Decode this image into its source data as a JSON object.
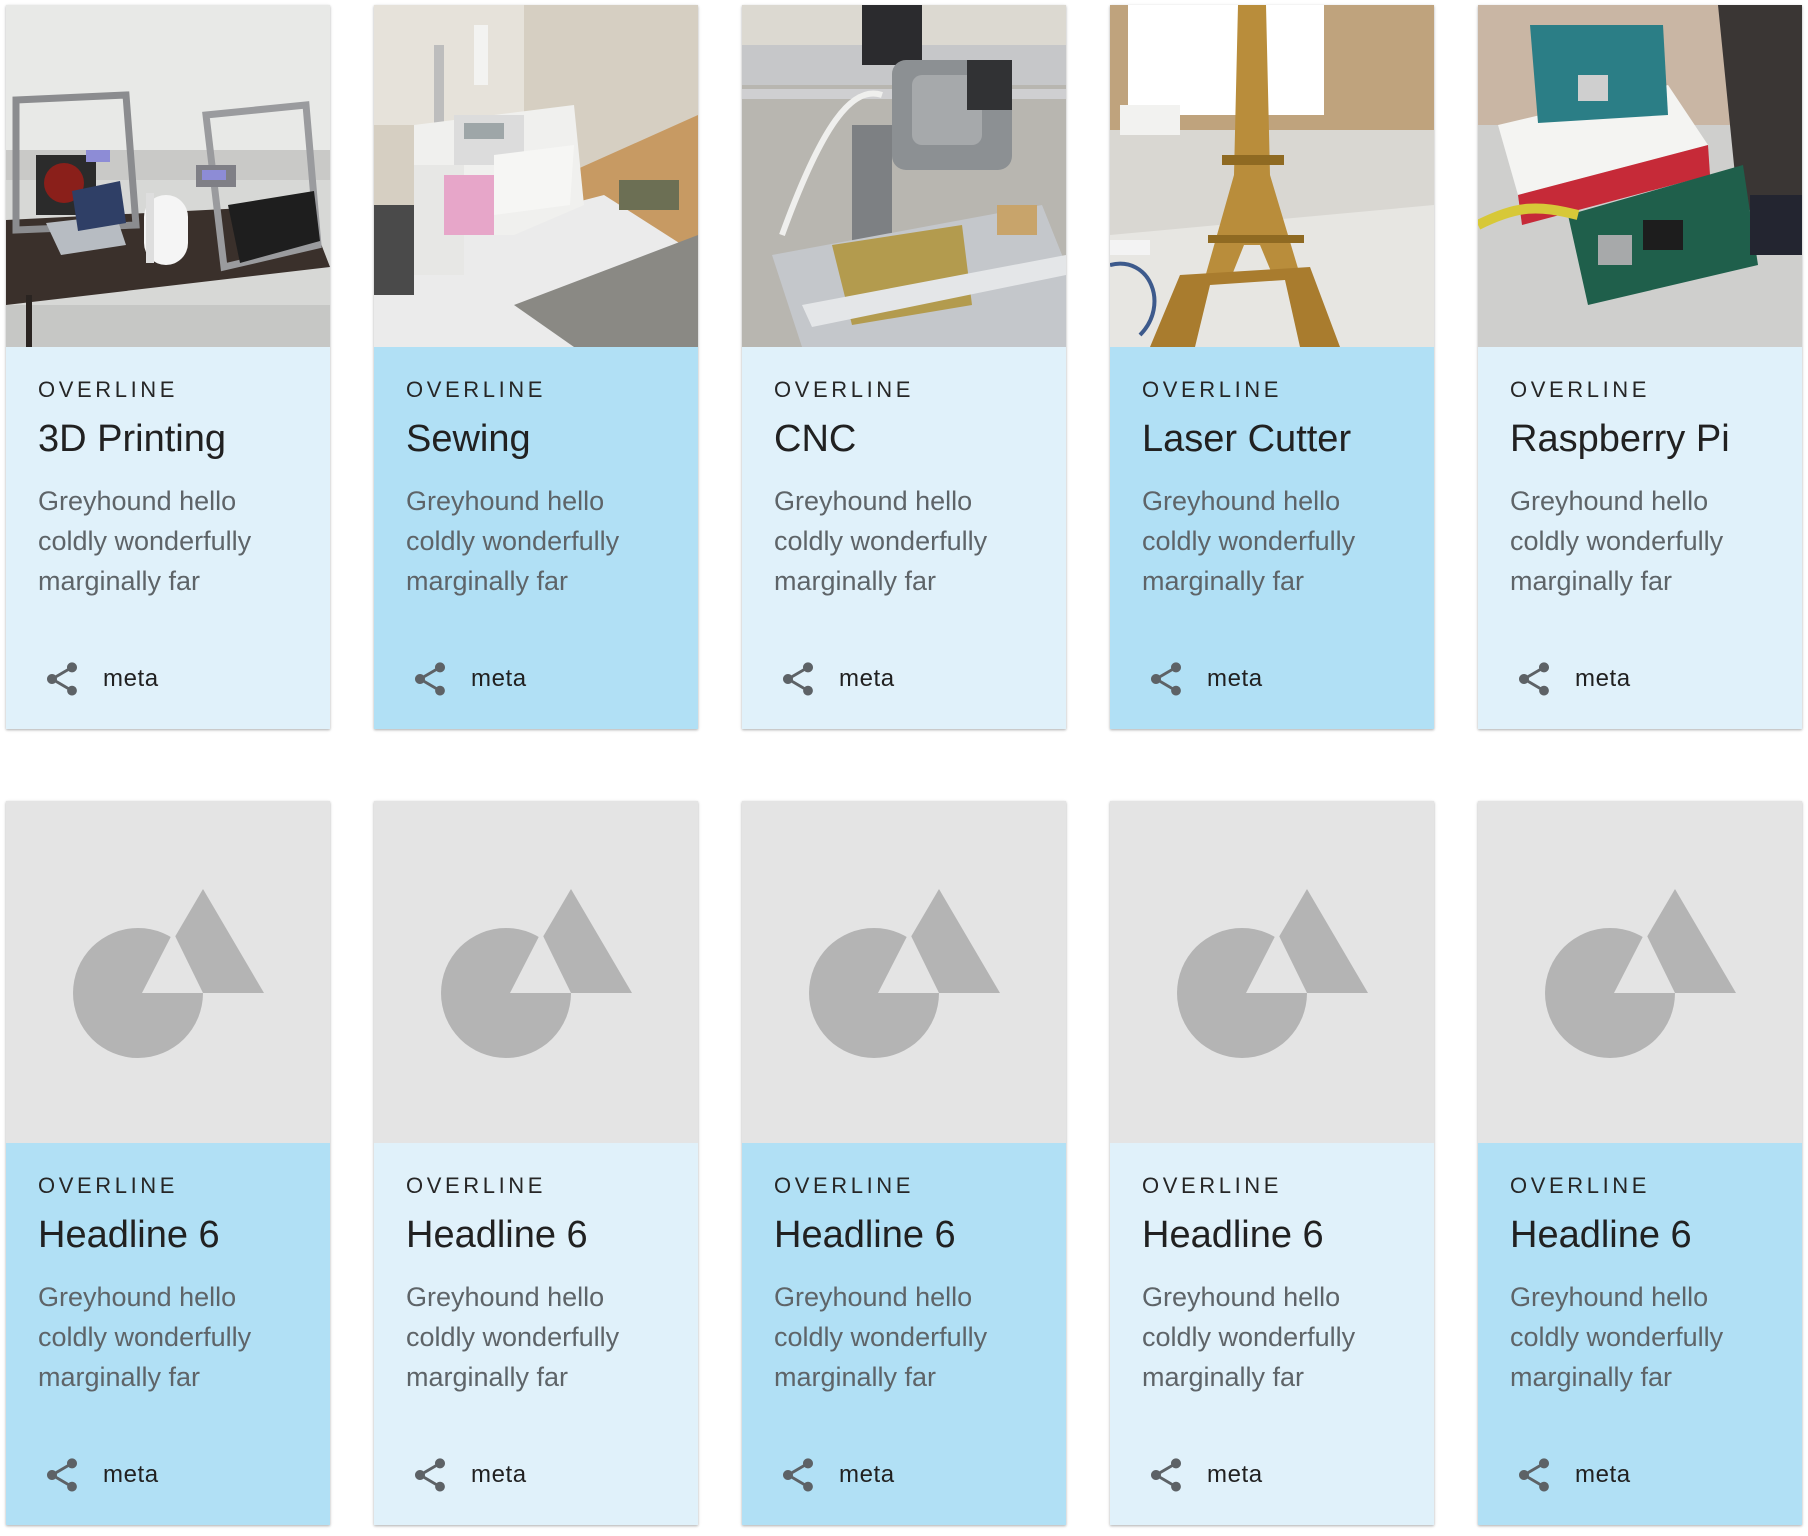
{
  "colors": {
    "card_light": "#e0f1fa",
    "card_dark": "#b1e0f5",
    "placeholder_bg": "#e4e4e4",
    "placeholder_shape": "#b4b4b4",
    "icon": "#5d6266"
  },
  "photo_cards": [
    {
      "photo": "3d-printers-photo",
      "overline": "OVERLINE",
      "headline": "3D Printing",
      "body": [
        "Greyhound hello",
        "coldly wonderfully",
        "marginally far"
      ],
      "meta": "meta",
      "tone": "light"
    },
    {
      "photo": "sewing-machine-photo",
      "overline": "OVERLINE",
      "headline": "Sewing",
      "body": [
        "Greyhound hello",
        "coldly wonderfully",
        "marginally far"
      ],
      "meta": "meta",
      "tone": "dark"
    },
    {
      "photo": "cnc-machine-photo",
      "overline": "OVERLINE",
      "headline": "CNC",
      "body": [
        "Greyhound hello",
        "coldly wonderfully",
        "marginally far"
      ],
      "meta": "meta",
      "tone": "light"
    },
    {
      "photo": "laser-cut-eiffel-tower-photo",
      "overline": "OVERLINE",
      "headline": "Laser Cutter",
      "body": [
        "Greyhound hello",
        "coldly wonderfully",
        "marginally far"
      ],
      "meta": "meta",
      "tone": "dark"
    },
    {
      "photo": "raspberry-pi-photo",
      "overline": "OVERLINE",
      "headline": "Raspberry Pi",
      "body": [
        "Greyhound hello",
        "coldly wonderfully",
        "marginally far"
      ],
      "meta": "meta",
      "tone": "light"
    }
  ],
  "placeholder_cards": [
    {
      "overline": "OVERLINE",
      "headline": "Headline 6",
      "body": [
        "Greyhound hello",
        "coldly wonderfully",
        "marginally far"
      ],
      "meta": "meta",
      "tone": "dark"
    },
    {
      "overline": "OVERLINE",
      "headline": "Headline 6",
      "body": [
        "Greyhound hello",
        "coldly wonderfully",
        "marginally far"
      ],
      "meta": "meta",
      "tone": "light"
    },
    {
      "overline": "OVERLINE",
      "headline": "Headline 6",
      "body": [
        "Greyhound hello",
        "coldly wonderfully",
        "marginally far"
      ],
      "meta": "meta",
      "tone": "dark"
    },
    {
      "overline": "OVERLINE",
      "headline": "Headline 6",
      "body": [
        "Greyhound hello",
        "coldly wonderfully",
        "marginally far"
      ],
      "meta": "meta",
      "tone": "light"
    },
    {
      "overline": "OVERLINE",
      "headline": "Headline 6",
      "body": [
        "Greyhound hello",
        "coldly wonderfully",
        "marginally far"
      ],
      "meta": "meta",
      "tone": "dark"
    }
  ],
  "icons": {
    "meta": "share-icon",
    "placeholder": "image-placeholder-icon"
  }
}
